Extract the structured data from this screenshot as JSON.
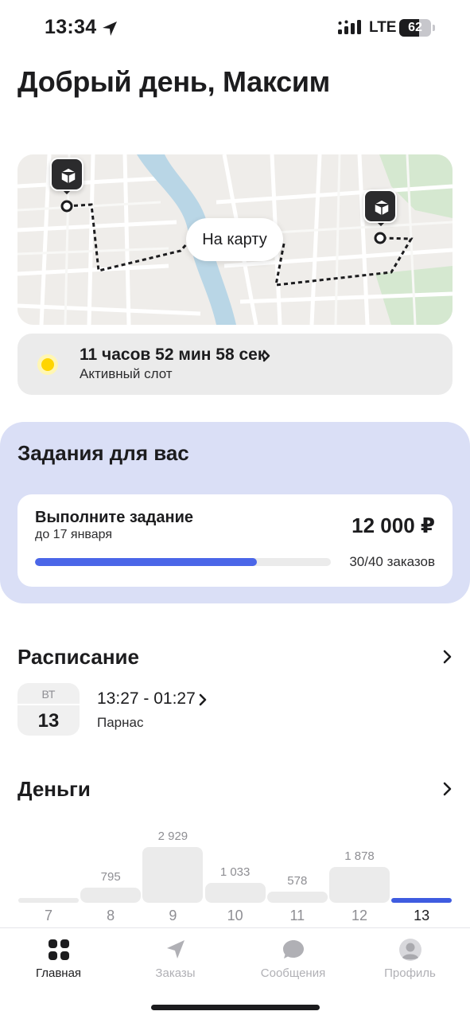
{
  "status_bar": {
    "time": "13:34",
    "network": "LTE",
    "battery": "62",
    "battery_level": 0.62,
    "icons": [
      "location-arrow-icon",
      "signal-icon",
      "battery-icon"
    ]
  },
  "greeting": "Добрый день, Максим",
  "map": {
    "button_label": "На карту",
    "colors": {
      "background": "#efedea",
      "river": "#b9d6e6",
      "park": "#d5e8d0",
      "route": "#1c1c1e"
    },
    "icons": [
      "package-icon",
      "package-icon"
    ]
  },
  "active_slot": {
    "countdown": "11 часов 52 мин 58 сек",
    "label": "Активный слот",
    "icon": "sun-icon",
    "icon_color": "#ffd500"
  },
  "tasks": {
    "title": "Задания для вас",
    "card": {
      "name": "Выполните задание",
      "deadline": "до 17 января",
      "reward": "12 000 ₽",
      "progress_text": "30/40 заказов",
      "progress": 0.75
    },
    "colors": {
      "block_bg": "#dadff6",
      "progress": "#4b66e8"
    }
  },
  "schedule": {
    "title": "Расписание",
    "weekday": "ВТ",
    "day": "13",
    "shift_time": "13:27 - 01:27",
    "place": "Парнас"
  },
  "money": {
    "title": "Деньги"
  },
  "chart_data": {
    "type": "bar",
    "categories": [
      "7",
      "8",
      "9",
      "10",
      "11",
      "12",
      "13"
    ],
    "values": [
      0,
      795,
      2929,
      1033,
      578,
      1878,
      0
    ],
    "value_labels": [
      "",
      "795",
      "2 929",
      "1 033",
      "578",
      "1 878",
      ""
    ],
    "active_category": "13",
    "title": "",
    "xlabel": "",
    "ylabel": "",
    "ylim": [
      0,
      2929
    ],
    "grid": false,
    "colors": {
      "bar": "#ebebeb",
      "active": "#3f5ce0"
    }
  },
  "tab_bar": {
    "tabs": [
      {
        "label": "Главная",
        "icon": "home-grid-icon",
        "active": true
      },
      {
        "label": "Заказы",
        "icon": "navigation-arrow-icon",
        "active": false
      },
      {
        "label": "Сообщения",
        "icon": "chat-bubble-icon",
        "active": false
      },
      {
        "label": "Профиль",
        "icon": "avatar-icon",
        "active": false
      }
    ]
  }
}
